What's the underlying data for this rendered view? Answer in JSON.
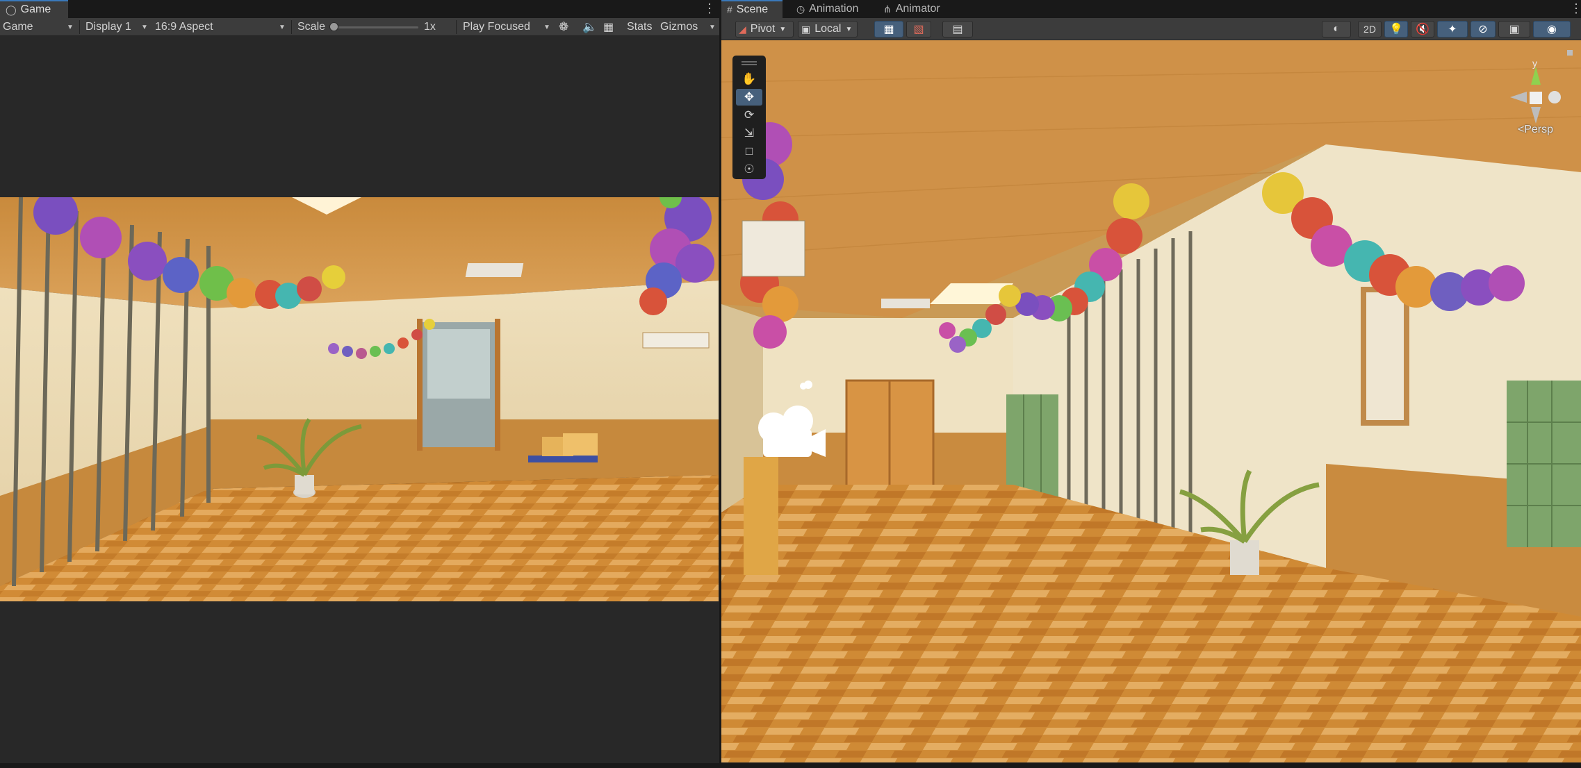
{
  "game": {
    "tab_title": "Game",
    "toolbar": {
      "view_mode": "Game",
      "display": "Display 1",
      "aspect": "16:9 Aspect",
      "scale_label": "Scale",
      "scale_value": "1x",
      "scale_fraction": 0.0,
      "play_mode": "Play Focused",
      "stats": "Stats",
      "gizmos": "Gizmos"
    }
  },
  "scene": {
    "tabs": [
      {
        "label": "Scene",
        "icon": "grid-icon",
        "active": true
      },
      {
        "label": "Animation",
        "icon": "clock-icon",
        "active": false
      },
      {
        "label": "Animator",
        "icon": "animator-icon",
        "active": false
      }
    ],
    "toolbar": {
      "pivot": "Pivot",
      "space": "Local",
      "mode_2d": "2D"
    },
    "tools": [
      "hand-tool",
      "move-tool",
      "rotate-tool",
      "scale-tool",
      "rect-tool",
      "transform-tool"
    ],
    "active_tool": "move-tool",
    "projection": "Persp",
    "gizmo_axis_label": "y"
  },
  "colors": {
    "accent": "#3a79bb",
    "active_button": "#46607c",
    "panel_bg": "#282828",
    "toolbar_bg": "#3c3c3c"
  }
}
